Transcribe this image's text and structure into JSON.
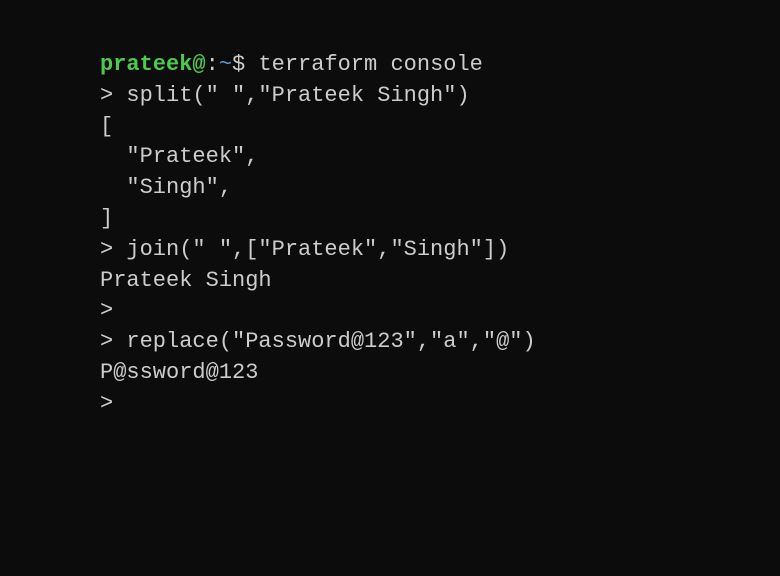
{
  "shell_prompt": {
    "user": "prateek",
    "at": "@",
    "colon": ":",
    "path": "~",
    "dollar": "$ "
  },
  "lines": {
    "l0_cmd": "terraform console",
    "l1": "> split(\" \",\"Prateek Singh\")",
    "l2": "[",
    "l3": "  \"Prateek\",",
    "l4": "  \"Singh\",",
    "l5": "]",
    "l6": "> join(\" \",[\"Prateek\",\"Singh\"])",
    "l7": "Prateek Singh",
    "l8": ">",
    "l9": "",
    "l10": "> replace(\"Password@123\",\"a\",\"@\")",
    "l11": "P@ssword@123",
    "l12": ">"
  }
}
